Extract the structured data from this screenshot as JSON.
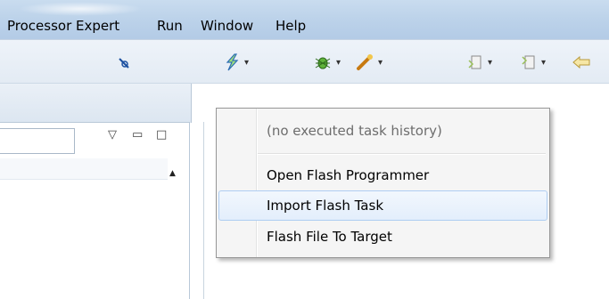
{
  "menubar": {
    "items": [
      "Processor Expert",
      "Run",
      "Window",
      "Help"
    ]
  },
  "toolbar": {
    "icons": [
      "pin-icon",
      "flash-icon",
      "debug-bug-icon",
      "external-tools-icon",
      "next-annotation-icon",
      "previous-annotation-icon",
      "back-icon"
    ],
    "arrow_glyph": "▾"
  },
  "panel": {
    "view_menu_glyph": "▽",
    "minimize_glyph": "▭",
    "maximize_glyph": "□",
    "scroll_up_glyph": "▲"
  },
  "flash_menu": {
    "items": [
      {
        "label": "(no executed task history)",
        "enabled": false
      },
      {
        "label": "Open Flash Programmer",
        "enabled": true
      },
      {
        "label": "Import Flash Task",
        "enabled": true,
        "hovered": true
      },
      {
        "label": "Flash File To Target",
        "enabled": true
      }
    ]
  },
  "colors": {
    "titlebar": "#bdd3ea",
    "toolbar": "#e8eff7",
    "menu_bg": "#f5f5f5",
    "hover_border": "#aecdf2"
  }
}
